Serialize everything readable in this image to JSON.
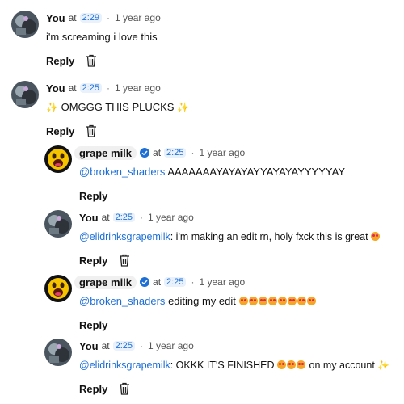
{
  "comments": [
    {
      "author": "You",
      "at": "at",
      "timestamp": "2:29",
      "ago": "1 year ago",
      "text": "i'm screaming i love this",
      "reply_label": "Reply",
      "avatar": "galaxy-avatar"
    },
    {
      "author": "You",
      "at": "at",
      "timestamp": "2:25",
      "ago": "1 year ago",
      "text_pre": "✨",
      "text": "OMGGG THIS PLUCKS",
      "text_post": "✨",
      "reply_label": "Reply",
      "avatar": "galaxy-avatar"
    },
    {
      "author": "grape milk",
      "verified": true,
      "at": "at",
      "timestamp": "2:25",
      "ago": "1 year ago",
      "mention": "@broken_shaders",
      "text": "AAAAAAAYAYAYAYYAYAYAYYYYYAY",
      "reply_label": "Reply",
      "avatar": "emoji-avatar"
    },
    {
      "author": "You",
      "at": "at",
      "timestamp": "2:25",
      "ago": "1 year ago",
      "mention": "@elidrinksgrapemilk",
      "text": ": i'm making an edit rn, holy fxck this is great",
      "reply_label": "Reply",
      "avatar": "galaxy-avatar"
    },
    {
      "author": "grape milk",
      "verified": true,
      "at": "at",
      "timestamp": "2:25",
      "ago": "1 year ago",
      "mention": "@broken_shaders",
      "text": "editing my edit",
      "reply_label": "Reply",
      "avatar": "emoji-avatar"
    },
    {
      "author": "You",
      "at": "at",
      "timestamp": "2:25",
      "ago": "1 year ago",
      "mention": "@elidrinksgrapemilk",
      "text": ": OKKK IT'S FINISHED",
      "text_after": "on my account",
      "text_post": "✨",
      "reply_label": "Reply",
      "avatar": "galaxy-avatar"
    }
  ],
  "separator": "·",
  "colors": {
    "mention": "#1d6fd6",
    "timestamp_bg": "#e8f1fc",
    "verified": "#1d6fd6"
  }
}
